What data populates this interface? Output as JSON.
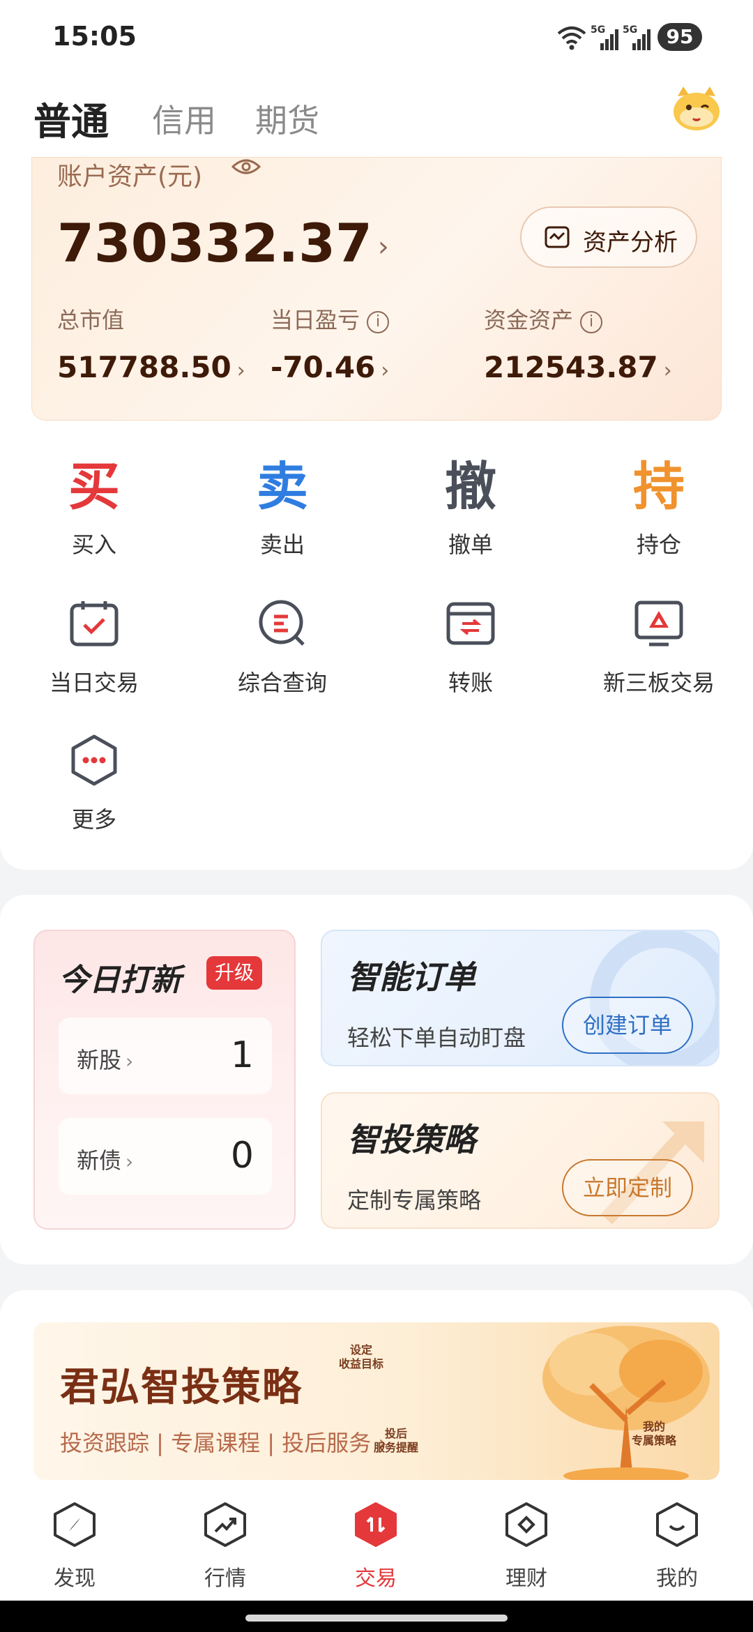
{
  "status_bar": {
    "time": "15:05",
    "battery": "95",
    "net1": "5G",
    "net2": "5G"
  },
  "header": {
    "tabs": [
      {
        "label": "普通",
        "active": true
      },
      {
        "label": "信用",
        "active": false
      },
      {
        "label": "期货",
        "active": false
      }
    ]
  },
  "asset": {
    "title": "账户资产(元)",
    "total": "730332.37",
    "analysis_label": "资产分析",
    "stats": [
      {
        "label": "总市值",
        "value": "517788.50",
        "info": false
      },
      {
        "label": "当日盈亏",
        "value": "-70.46",
        "info": true
      },
      {
        "label": "资金资产",
        "value": "212543.87",
        "info": true
      }
    ]
  },
  "actions": {
    "primary": [
      {
        "glyph": "买",
        "label": "买入",
        "color": "#e4383a"
      },
      {
        "glyph": "卖",
        "label": "卖出",
        "color": "#2f7de1"
      },
      {
        "glyph": "撤",
        "label": "撤单",
        "color": "#4a4f5a"
      },
      {
        "glyph": "持",
        "label": "持仓",
        "color": "#f0922d"
      }
    ],
    "secondary": [
      {
        "label": "当日交易",
        "icon": "calendar-check-icon"
      },
      {
        "label": "综合查询",
        "icon": "search-query-icon"
      },
      {
        "label": "转账",
        "icon": "transfer-icon"
      },
      {
        "label": "新三板交易",
        "icon": "monitor-triangle-icon"
      },
      {
        "label": "更多",
        "icon": "more-hexagon-icon"
      }
    ]
  },
  "ipo": {
    "title": "今日打新",
    "badge": "升级",
    "rows": [
      {
        "label": "新股",
        "count": "1"
      },
      {
        "label": "新债",
        "count": "0"
      }
    ]
  },
  "smart_order": {
    "title": "智能订单",
    "subtitle": "轻松下单自动盯盘",
    "button": "创建订单"
  },
  "strategy": {
    "title": "智投策略",
    "subtitle": "定制专属策略",
    "button": "立即定制"
  },
  "banner": {
    "title": "君弘智投策略",
    "subtitle": "投资跟踪 | 专属课程 | 投后服务 ›",
    "tags": [
      "设定\n收益目标",
      "投后\n服务提醒",
      "我的\n专属策略"
    ]
  },
  "bottom_nav": {
    "items": [
      {
        "label": "发现",
        "active": false
      },
      {
        "label": "行情",
        "active": false
      },
      {
        "label": "交易",
        "active": true
      },
      {
        "label": "理财",
        "active": false
      },
      {
        "label": "我的",
        "active": false
      }
    ]
  },
  "colors": {
    "accent_red": "#e4383a",
    "sell_blue": "#2f7de1",
    "hold_orange": "#f0922d",
    "asset_brown": "#3e1a08"
  }
}
